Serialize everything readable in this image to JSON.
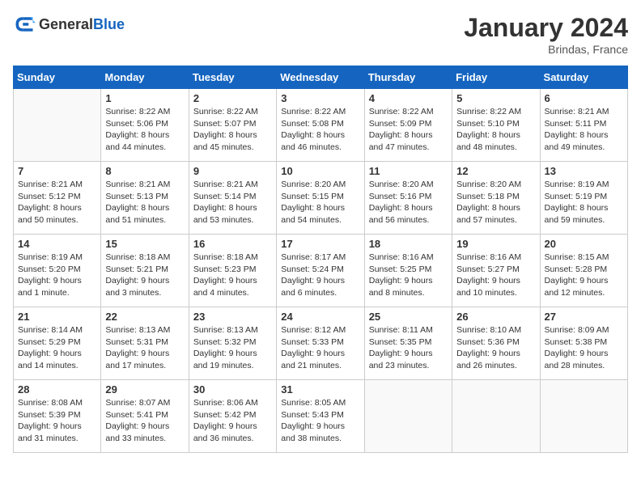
{
  "header": {
    "logo_general": "General",
    "logo_blue": "Blue",
    "month": "January 2024",
    "location": "Brindas, France"
  },
  "weekdays": [
    "Sunday",
    "Monday",
    "Tuesday",
    "Wednesday",
    "Thursday",
    "Friday",
    "Saturday"
  ],
  "weeks": [
    [
      {
        "day": "",
        "info": ""
      },
      {
        "day": "1",
        "info": "Sunrise: 8:22 AM\nSunset: 5:06 PM\nDaylight: 8 hours\nand 44 minutes."
      },
      {
        "day": "2",
        "info": "Sunrise: 8:22 AM\nSunset: 5:07 PM\nDaylight: 8 hours\nand 45 minutes."
      },
      {
        "day": "3",
        "info": "Sunrise: 8:22 AM\nSunset: 5:08 PM\nDaylight: 8 hours\nand 46 minutes."
      },
      {
        "day": "4",
        "info": "Sunrise: 8:22 AM\nSunset: 5:09 PM\nDaylight: 8 hours\nand 47 minutes."
      },
      {
        "day": "5",
        "info": "Sunrise: 8:22 AM\nSunset: 5:10 PM\nDaylight: 8 hours\nand 48 minutes."
      },
      {
        "day": "6",
        "info": "Sunrise: 8:21 AM\nSunset: 5:11 PM\nDaylight: 8 hours\nand 49 minutes."
      }
    ],
    [
      {
        "day": "7",
        "info": "Sunrise: 8:21 AM\nSunset: 5:12 PM\nDaylight: 8 hours\nand 50 minutes."
      },
      {
        "day": "8",
        "info": "Sunrise: 8:21 AM\nSunset: 5:13 PM\nDaylight: 8 hours\nand 51 minutes."
      },
      {
        "day": "9",
        "info": "Sunrise: 8:21 AM\nSunset: 5:14 PM\nDaylight: 8 hours\nand 53 minutes."
      },
      {
        "day": "10",
        "info": "Sunrise: 8:20 AM\nSunset: 5:15 PM\nDaylight: 8 hours\nand 54 minutes."
      },
      {
        "day": "11",
        "info": "Sunrise: 8:20 AM\nSunset: 5:16 PM\nDaylight: 8 hours\nand 56 minutes."
      },
      {
        "day": "12",
        "info": "Sunrise: 8:20 AM\nSunset: 5:18 PM\nDaylight: 8 hours\nand 57 minutes."
      },
      {
        "day": "13",
        "info": "Sunrise: 8:19 AM\nSunset: 5:19 PM\nDaylight: 8 hours\nand 59 minutes."
      }
    ],
    [
      {
        "day": "14",
        "info": "Sunrise: 8:19 AM\nSunset: 5:20 PM\nDaylight: 9 hours\nand 1 minute."
      },
      {
        "day": "15",
        "info": "Sunrise: 8:18 AM\nSunset: 5:21 PM\nDaylight: 9 hours\nand 3 minutes."
      },
      {
        "day": "16",
        "info": "Sunrise: 8:18 AM\nSunset: 5:23 PM\nDaylight: 9 hours\nand 4 minutes."
      },
      {
        "day": "17",
        "info": "Sunrise: 8:17 AM\nSunset: 5:24 PM\nDaylight: 9 hours\nand 6 minutes."
      },
      {
        "day": "18",
        "info": "Sunrise: 8:16 AM\nSunset: 5:25 PM\nDaylight: 9 hours\nand 8 minutes."
      },
      {
        "day": "19",
        "info": "Sunrise: 8:16 AM\nSunset: 5:27 PM\nDaylight: 9 hours\nand 10 minutes."
      },
      {
        "day": "20",
        "info": "Sunrise: 8:15 AM\nSunset: 5:28 PM\nDaylight: 9 hours\nand 12 minutes."
      }
    ],
    [
      {
        "day": "21",
        "info": "Sunrise: 8:14 AM\nSunset: 5:29 PM\nDaylight: 9 hours\nand 14 minutes."
      },
      {
        "day": "22",
        "info": "Sunrise: 8:13 AM\nSunset: 5:31 PM\nDaylight: 9 hours\nand 17 minutes."
      },
      {
        "day": "23",
        "info": "Sunrise: 8:13 AM\nSunset: 5:32 PM\nDaylight: 9 hours\nand 19 minutes."
      },
      {
        "day": "24",
        "info": "Sunrise: 8:12 AM\nSunset: 5:33 PM\nDaylight: 9 hours\nand 21 minutes."
      },
      {
        "day": "25",
        "info": "Sunrise: 8:11 AM\nSunset: 5:35 PM\nDaylight: 9 hours\nand 23 minutes."
      },
      {
        "day": "26",
        "info": "Sunrise: 8:10 AM\nSunset: 5:36 PM\nDaylight: 9 hours\nand 26 minutes."
      },
      {
        "day": "27",
        "info": "Sunrise: 8:09 AM\nSunset: 5:38 PM\nDaylight: 9 hours\nand 28 minutes."
      }
    ],
    [
      {
        "day": "28",
        "info": "Sunrise: 8:08 AM\nSunset: 5:39 PM\nDaylight: 9 hours\nand 31 minutes."
      },
      {
        "day": "29",
        "info": "Sunrise: 8:07 AM\nSunset: 5:41 PM\nDaylight: 9 hours\nand 33 minutes."
      },
      {
        "day": "30",
        "info": "Sunrise: 8:06 AM\nSunset: 5:42 PM\nDaylight: 9 hours\nand 36 minutes."
      },
      {
        "day": "31",
        "info": "Sunrise: 8:05 AM\nSunset: 5:43 PM\nDaylight: 9 hours\nand 38 minutes."
      },
      {
        "day": "",
        "info": ""
      },
      {
        "day": "",
        "info": ""
      },
      {
        "day": "",
        "info": ""
      }
    ]
  ]
}
